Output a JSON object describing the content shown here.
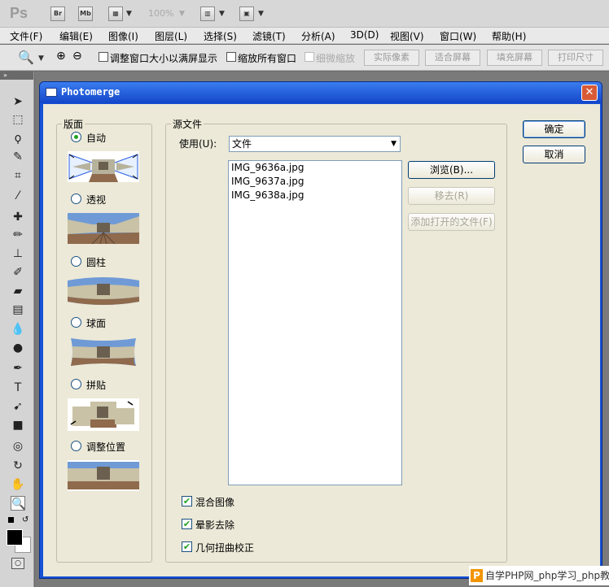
{
  "app": {
    "logo": "Ps",
    "bridge": "Br",
    "minibridge": "Mb",
    "zoom": "100%"
  },
  "menu": [
    "文件(F)",
    "编辑(E)",
    "图像(I)",
    "图层(L)",
    "选择(S)",
    "滤镜(T)",
    "分析(A)",
    "3D(D)",
    "视图(V)",
    "窗口(W)",
    "帮助(H)"
  ],
  "options": {
    "resize_windows": "调整窗口大小以满屏显示",
    "zoom_all": "缩放所有窗口",
    "scrubby": "细微缩放",
    "actual_pixels": "实际像素",
    "fit_screen": "适合屏幕",
    "fill_screen": "填充屏幕",
    "print_size": "打印尺寸"
  },
  "dialog": {
    "title": "Photomerge",
    "layout_legend": "版面",
    "layouts": [
      "自动",
      "透视",
      "圆柱",
      "球面",
      "拼贴",
      "调整位置"
    ],
    "selected_layout": "自动",
    "source_legend": "源文件",
    "use_label": "使用(U):",
    "use_value": "文件",
    "files": [
      "IMG_9636a.jpg",
      "IMG_9637a.jpg",
      "IMG_9638a.jpg"
    ],
    "browse": "浏览(B)...",
    "remove": "移去(R)",
    "add_open": "添加打开的文件(F)",
    "ok": "确定",
    "cancel": "取消",
    "options": [
      {
        "label": "混合图像",
        "checked": true
      },
      {
        "label": "晕影去除",
        "checked": true
      },
      {
        "label": "几何扭曲校正",
        "checked": true
      }
    ]
  },
  "watermark": "自学PHP网_php学习_php教程"
}
